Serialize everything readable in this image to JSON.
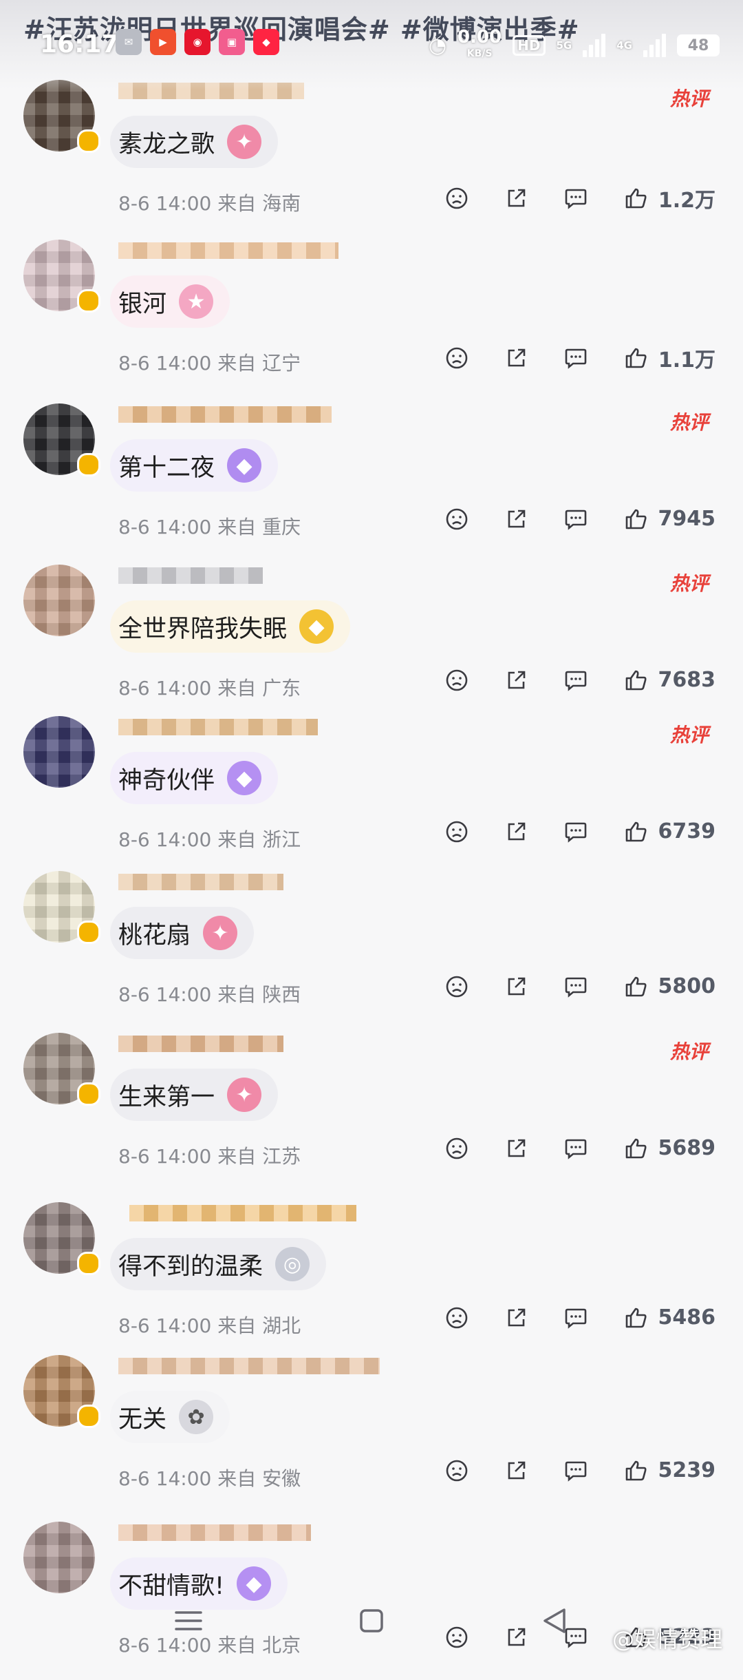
{
  "status_bar": {
    "hashtags": "#汪苏泷明日世界巡回演唱会# #微博演出季#",
    "time": "16:17",
    "app_icons": [
      "message-icon",
      "video-icon",
      "weibo-icon",
      "bilibili-icon",
      "xiaohongshu-icon"
    ],
    "net_speed": "0.00",
    "net_unit": "KB/S",
    "hd_label": "HD",
    "signal_1": "5G",
    "signal_2": "4G",
    "battery": "48"
  },
  "labels": {
    "hot": "热评"
  },
  "comments": [
    {
      "content": "素龙之歌",
      "date": "8-6 14:00",
      "location": "来自 海南",
      "likes": "1.2万",
      "hot": true,
      "bubble_bg": "#ededf1"
    },
    {
      "content": "银河",
      "date": "8-6 14:00",
      "location": "来自 辽宁",
      "likes": "1.1万",
      "hot": false,
      "bubble_bg": "#fbeef3"
    },
    {
      "content": "第十二夜",
      "date": "8-6 14:00",
      "location": "来自 重庆",
      "likes": "7945",
      "hot": true,
      "bubble_bg": "#f2effa"
    },
    {
      "content": "全世界陪我失眠",
      "date": "8-6 14:00",
      "location": "来自 广东",
      "likes": "7683",
      "hot": true,
      "bubble_bg": "#fbf5e6"
    },
    {
      "content": "神奇伙伴",
      "date": "8-6 14:00",
      "location": "来自 浙江",
      "likes": "6739",
      "hot": true,
      "bubble_bg": "#f3eefb"
    },
    {
      "content": "桃花扇",
      "date": "8-6 14:00",
      "location": "来自 陕西",
      "likes": "5800",
      "hot": false,
      "bubble_bg": "#ededf1"
    },
    {
      "content": "生来第一",
      "date": "8-6 14:00",
      "location": "来自 江苏",
      "likes": "5689",
      "hot": true,
      "bubble_bg": "#ededf1"
    },
    {
      "content": "得不到的温柔",
      "date": "8-6 14:00",
      "location": "来自 湖北",
      "likes": "5486",
      "hot": false,
      "bubble_bg": "#ededf1"
    },
    {
      "content": "无关",
      "date": "8-6 14:00",
      "location": "来自 安徽",
      "likes": "5239",
      "hot": false,
      "bubble_bg": "#f4f4f6"
    },
    {
      "content": "不甜情歌!",
      "date": "8-6 14:00",
      "location": "来自 北京",
      "likes": "5223",
      "hot": false,
      "bubble_bg": "#f2effa"
    }
  ],
  "watermark": "@娱情赞理",
  "colors": {
    "hot": "#e8413a",
    "meta": "#888a90",
    "verified": "#f4b400"
  }
}
